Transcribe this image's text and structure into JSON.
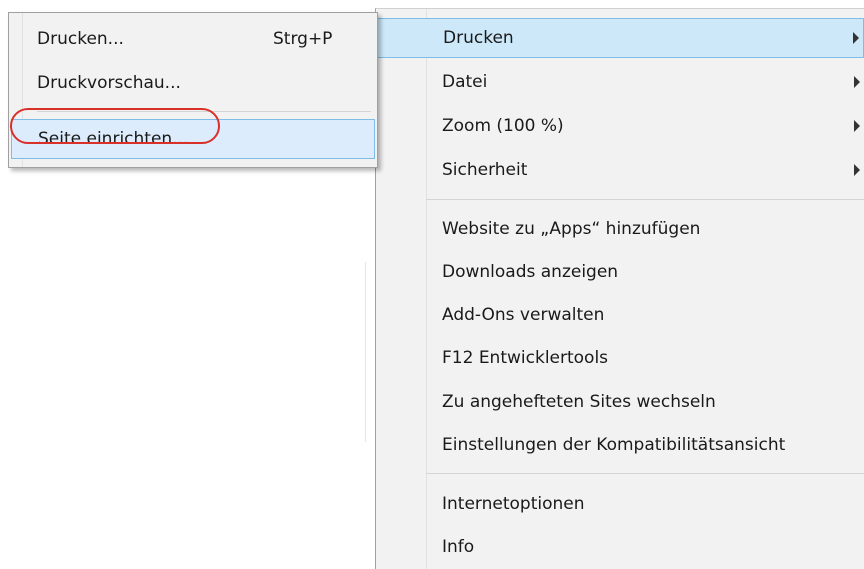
{
  "main_menu": {
    "items": [
      {
        "label": "Drucken"
      },
      {
        "label": "Datei"
      },
      {
        "label": "Zoom (100 %)"
      },
      {
        "label": "Sicherheit"
      },
      {
        "label": "Website zu „Apps“ hinzufügen"
      },
      {
        "label": "Downloads anzeigen"
      },
      {
        "label": "Add-Ons verwalten"
      },
      {
        "label": "F12 Entwicklertools"
      },
      {
        "label": "Zu angehefteten Sites wechseln"
      },
      {
        "label": "Einstellungen der Kompatibilitätsansicht"
      },
      {
        "label": "Internetoptionen"
      },
      {
        "label": "Info"
      }
    ],
    "highlighted_index": 0
  },
  "submenu": {
    "items": [
      {
        "label": "Drucken...",
        "shortcut": "Strg+P"
      },
      {
        "label": "Druckvorschau..."
      },
      {
        "label": "Seite einrichten..."
      }
    ],
    "highlighted_index": 2
  },
  "colors": {
    "menu_background": "#f2f2f2",
    "highlight": "#cde8f9",
    "highlight_border": "#7fbde6",
    "annotation_oval": "#d9312a"
  }
}
